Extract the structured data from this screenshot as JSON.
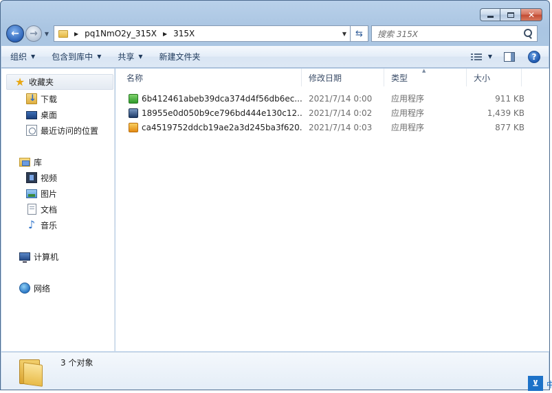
{
  "window": {
    "caption_buttons": [
      "minimize",
      "maximize",
      "close"
    ]
  },
  "address": {
    "crumbs": [
      "pq1NmO2y_315X",
      "315X"
    ]
  },
  "search": {
    "placeholder": "搜索 315X"
  },
  "toolbar": {
    "organize": "组织",
    "include_library": "包含到库中",
    "share": "共享",
    "new_folder": "新建文件夹"
  },
  "nav": {
    "favorites": "收藏夹",
    "downloads": "下载",
    "desktop": "桌面",
    "recent": "最近访问的位置",
    "libraries": "库",
    "videos": "视频",
    "pictures": "图片",
    "documents": "文档",
    "music": "音乐",
    "computer": "计算机",
    "network": "网络"
  },
  "columns": {
    "name": "名称",
    "date": "修改日期",
    "type": "类型",
    "size": "大小"
  },
  "files": [
    {
      "name": "6b412461abeb39dca374d4f56db6ec...",
      "date": "2021/7/14 0:00",
      "type": "应用程序",
      "size": "911 KB",
      "icon": "green-app-icon"
    },
    {
      "name": "18955e0d050b9ce796bd444e130c12...",
      "date": "2021/7/14 0:02",
      "type": "应用程序",
      "size": "1,439 KB",
      "icon": "navy-app-icon"
    },
    {
      "name": "ca4519752ddcb19ae2a3d245ba3f620...",
      "date": "2021/7/14 0:03",
      "type": "应用程序",
      "size": "877 KB",
      "icon": "orange-app-icon"
    }
  ],
  "details": {
    "count": "3 个对象"
  },
  "tray": {
    "ime_char": "中"
  },
  "colors": {
    "frame": "#b9d1ea",
    "close_button": "#c24a32",
    "ime": "#1d72c8"
  }
}
